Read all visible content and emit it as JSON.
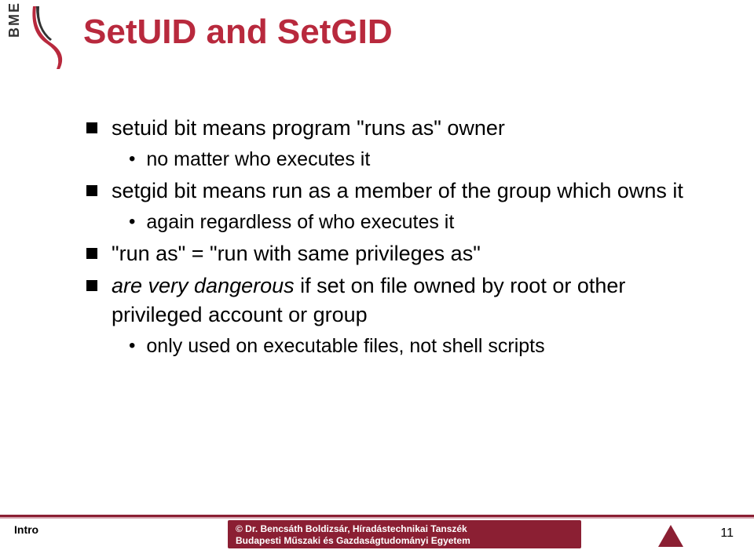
{
  "logo": {
    "bme": "BME"
  },
  "title": "SetUID and SetGID",
  "bullets": [
    {
      "text": "setuid bit means program \"runs as\" owner",
      "sub": [
        {
          "text": "no matter who executes it"
        }
      ]
    },
    {
      "text": "setgid bit means run as a member of the group which owns it",
      "sub": [
        {
          "text": "again regardless of who executes it"
        }
      ]
    },
    {
      "text": "\"run as\" = \"run with same privileges as\"",
      "sub": []
    },
    {
      "text_italic": "are very dangerous",
      "text_rest": " if set on file owned by root or other privileged account or group",
      "sub": [
        {
          "text": "only used on executable files, not shell scripts"
        }
      ]
    }
  ],
  "footer": {
    "label": "Intro",
    "line1": "©  Dr. Bencsáth Boldizsár, Híradástechnikai Tanszék",
    "line2": "Budapesti Műszaki és Gazdaságtudományi Egyetem",
    "page": "11"
  }
}
